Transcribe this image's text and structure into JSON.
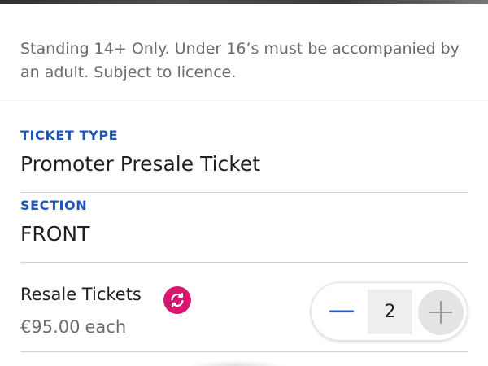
{
  "notice": "Standing 14+ Only. Under 16’s must be accompanied by an adult. Subject to licence.",
  "ticket_type": {
    "label": "TICKET TYPE",
    "value": "Promoter Presale Ticket"
  },
  "section": {
    "label": "SECTION",
    "value": "FRONT"
  },
  "resale": {
    "label": "Resale Tickets",
    "badge_icon": "resale-refresh-icon",
    "price": "€95.00",
    "unit": "each"
  },
  "quantity_stepper": {
    "value": "2",
    "minus_icon": "minus-icon",
    "plus_icon": "plus-icon"
  },
  "colors": {
    "label_blue": "#1f55b8",
    "resale_pink": "#d6196e",
    "text_dark": "#1f1f1f",
    "text_muted": "#6b6b6b"
  }
}
